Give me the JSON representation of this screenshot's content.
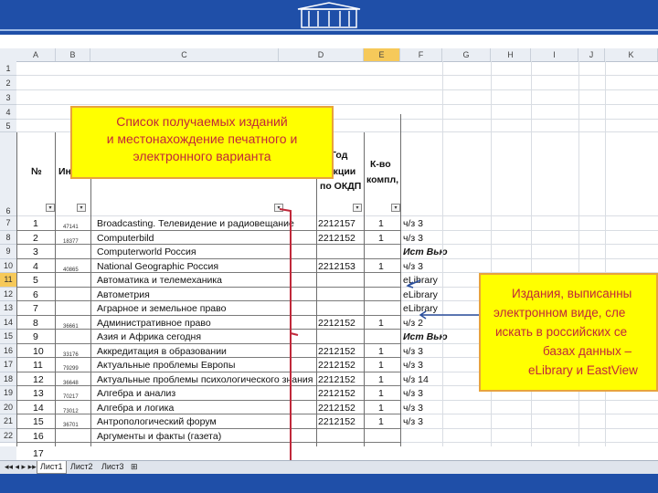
{
  "columns": [
    "A",
    "B",
    "C",
    "D",
    "E",
    "F",
    "G",
    "H",
    "I",
    "J",
    "K"
  ],
  "selected_column": "E",
  "header_block": {
    "num_label": "№",
    "index_partial": "Инд",
    "year_partial": "Год",
    "okdp_partial1": "дукции",
    "okdp_partial2": "по ОКДП",
    "qty_line1": "К-во",
    "qty_line2": "компл,"
  },
  "callout_top": {
    "line1": "Список  получаемых  изданий",
    "line2": "и местонахождение печатного и",
    "line3": "электронного варианта"
  },
  "callout_right": {
    "line1": "Издания, выписанны",
    "line2": "электронном виде, сле",
    "line3": "искать в российских се",
    "line4": "базах данных –",
    "line5": "eLibrary  и  EastView"
  },
  "rows": [
    {
      "r": "1",
      "n": "",
      "idx": "",
      "title": "",
      "code": "",
      "qty": "",
      "loc": ""
    },
    {
      "r": "2",
      "n": "",
      "idx": "",
      "title": "",
      "code": "",
      "qty": "",
      "loc": ""
    },
    {
      "r": "3",
      "n": "",
      "idx": "",
      "title": "",
      "code": "",
      "qty": "",
      "loc": ""
    },
    {
      "r": "4",
      "n": "",
      "idx": "",
      "title": "",
      "code": "",
      "qty": "",
      "loc": ""
    },
    {
      "r": "5",
      "n": "",
      "idx": "",
      "title": "",
      "code": "",
      "qty": "",
      "loc": ""
    },
    {
      "r": "6",
      "n": "",
      "idx": "",
      "title": "",
      "code": "",
      "qty": "",
      "loc": ""
    },
    {
      "r": "7",
      "n": "1",
      "idx": "47141",
      "title": "Broadcasting. Телевидение и радиовещание",
      "code": "2212157",
      "qty": "1",
      "loc": "ч/з 3"
    },
    {
      "r": "8",
      "n": "2",
      "idx": "18377",
      "title": "Computerbild",
      "code": "2212152",
      "qty": "1",
      "loc": "ч/з 3"
    },
    {
      "r": "9",
      "n": "3",
      "idx": "",
      "title": "Computerworld Россия",
      "code": "",
      "qty": "",
      "loc": "Ист Вью"
    },
    {
      "r": "10",
      "n": "4",
      "idx": "40865",
      "title": "National Geographic Россия",
      "code": "2212153",
      "qty": "1",
      "loc": "ч/з 3"
    },
    {
      "r": "11",
      "n": "5",
      "idx": "",
      "title": "Автоматика и телемеханика",
      "code": "",
      "qty": "",
      "loc": "eLibrary"
    },
    {
      "r": "12",
      "n": "6",
      "idx": "",
      "title": "Автометрия",
      "code": "",
      "qty": "",
      "loc": "eLibrary"
    },
    {
      "r": "13",
      "n": "7",
      "idx": "",
      "title": "Аграрное и земельное право",
      "code": "",
      "qty": "",
      "loc": "eLibrary"
    },
    {
      "r": "14",
      "n": "8",
      "idx": "36661",
      "title": "Административное право",
      "code": "2212152",
      "qty": "1",
      "loc": "ч/з 2"
    },
    {
      "r": "15",
      "n": "9",
      "idx": "",
      "title": "Азия и Африка сегодня",
      "code": "",
      "qty": "",
      "loc": "Ист Вью"
    },
    {
      "r": "16",
      "n": "10",
      "idx": "33176",
      "title": "Аккредитация в образовании",
      "code": "2212152",
      "qty": "1",
      "loc": "ч/з 3"
    },
    {
      "r": "17",
      "n": "11",
      "idx": "79299",
      "title": "Актуальные проблемы Европы",
      "code": "2212152",
      "qty": "1",
      "loc": "ч/з 3"
    },
    {
      "r": "18",
      "n": "12",
      "idx": "36648",
      "title": "Актуальные проблемы психологического знания",
      "code": "2212152",
      "qty": "1",
      "loc": "ч/з 14"
    },
    {
      "r": "19",
      "n": "13",
      "idx": "70217",
      "title": "Алгебра и анализ",
      "code": "2212152",
      "qty": "1",
      "loc": "ч/з 3"
    },
    {
      "r": "20",
      "n": "14",
      "idx": "73012",
      "title": "Алгебра и логика",
      "code": "2212152",
      "qty": "1",
      "loc": "ч/з 3"
    },
    {
      "r": "21",
      "n": "15",
      "idx": "36701",
      "title": "Антропологический форум",
      "code": "2212152",
      "qty": "1",
      "loc": "ч/з 3"
    },
    {
      "r": "22",
      "n": "16",
      "idx": "",
      "title": "Аргументы и факты (газета)",
      "code": "",
      "qty": "",
      "loc": ""
    },
    {
      "r": "",
      "n": "17",
      "idx": "",
      "title": "",
      "code": "",
      "qty": "",
      "loc": ""
    }
  ],
  "sheet_tabs": [
    "Лист1",
    "Лист2",
    "Лист3"
  ],
  "colors": {
    "banner": "#1f4fa8",
    "highlight": "#ffff00",
    "callout_text": "#c0283a",
    "bracket": "#c0283a"
  }
}
